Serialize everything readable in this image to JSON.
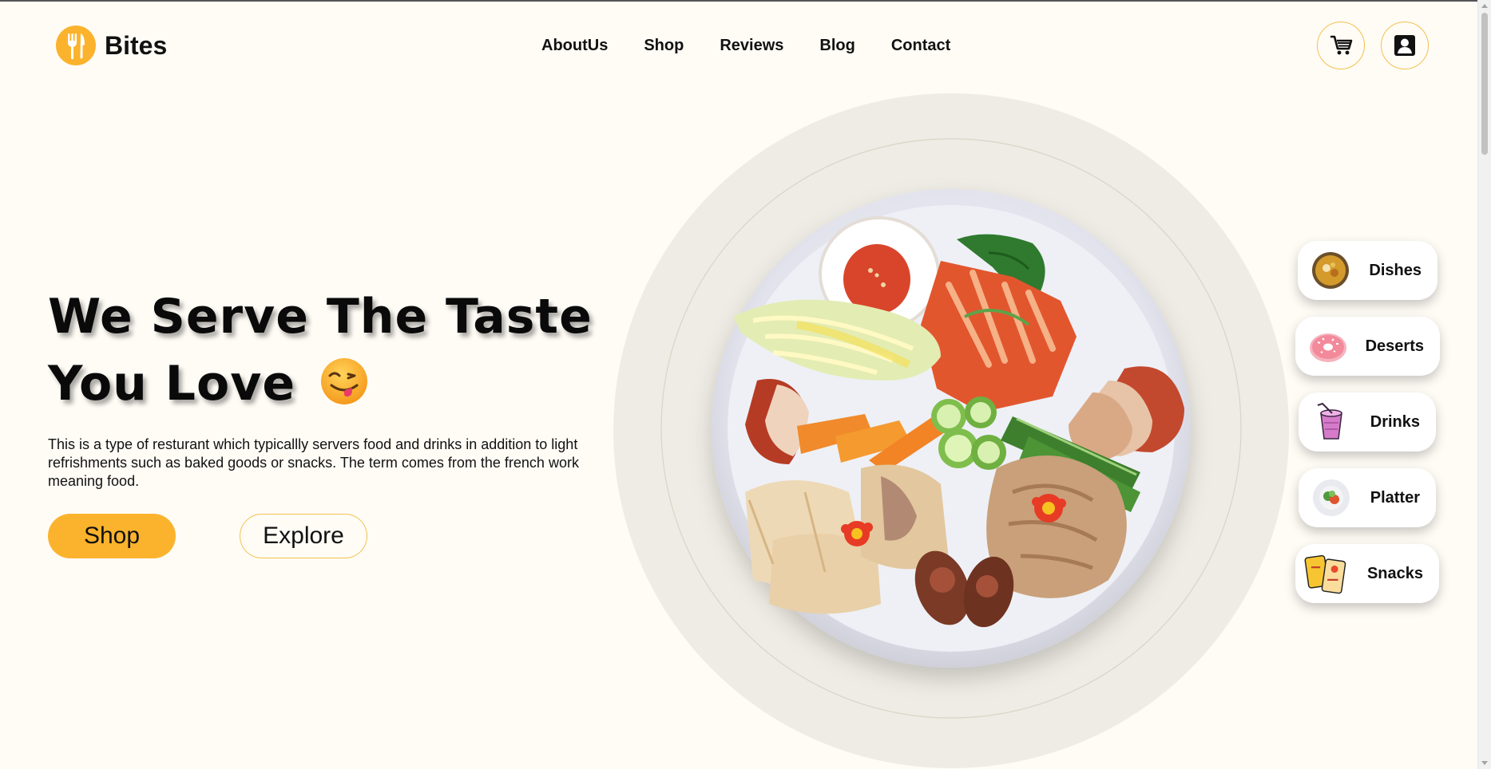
{
  "brand": {
    "name": "Bites",
    "logo_icon": "fork-knife-icon",
    "accent": "#fbb32d"
  },
  "nav": {
    "items": [
      "AboutUs",
      "Shop",
      "Reviews",
      "Blog",
      "Contact"
    ]
  },
  "header_icons": {
    "cart": "cart-icon",
    "account": "account-icon"
  },
  "hero": {
    "headline_line1": "We Serve The Taste",
    "headline_line2": "You Love",
    "emoji": "😋",
    "description": "This is a type of resturant which typicallly servers food and drinks in addition to light refrishments such as baked goods or snacks. The term comes from the french work meaning food.",
    "primary_button": "Shop",
    "secondary_button": "Explore"
  },
  "categories": [
    {
      "label": "Dishes",
      "icon": "curry-bowl-icon"
    },
    {
      "label": "Deserts",
      "icon": "donut-icon"
    },
    {
      "label": "Drinks",
      "icon": "smoothie-cup-icon"
    },
    {
      "label": "Platter",
      "icon": "salad-plate-icon"
    },
    {
      "label": "Snacks",
      "icon": "chips-bag-icon"
    }
  ],
  "colors": {
    "background": "#fffcf6",
    "accent": "#fbb32d",
    "plate_backdrop": "#efece5"
  }
}
